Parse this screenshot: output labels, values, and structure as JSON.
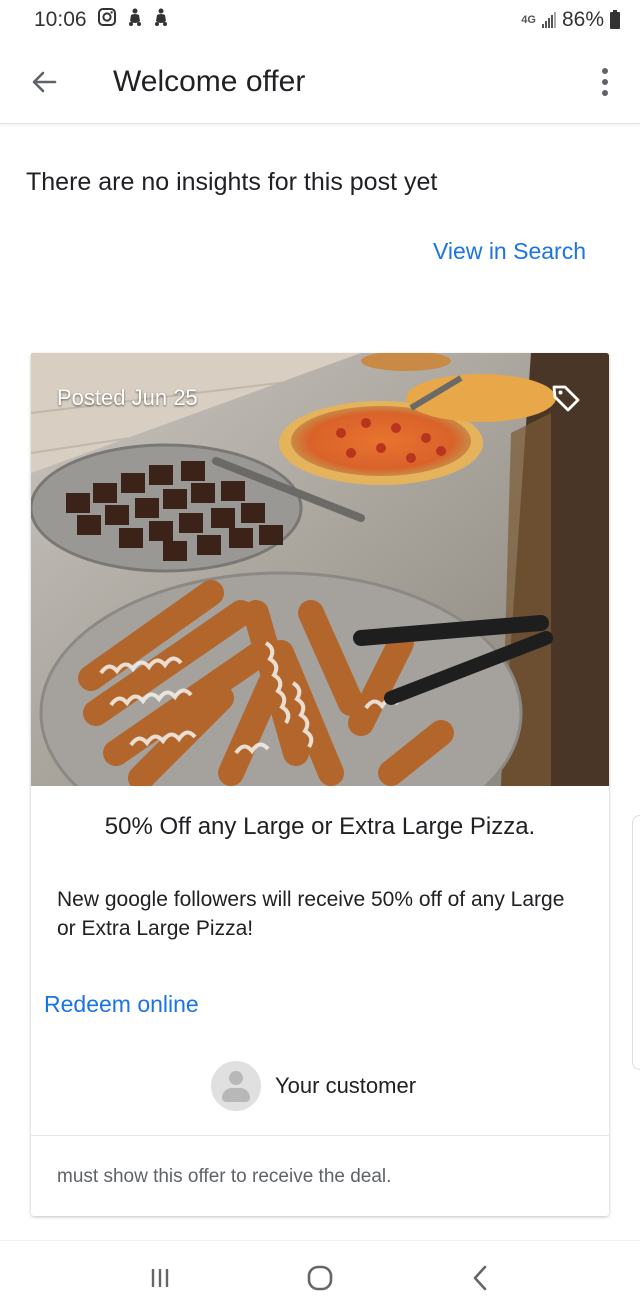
{
  "status_bar": {
    "time": "10:06",
    "network": "4G",
    "battery": "86%",
    "icons": [
      "instagram-icon",
      "notification-icon",
      "notification-icon"
    ]
  },
  "app_bar": {
    "title": "Welcome offer",
    "back_icon": "arrow-back-icon",
    "menu_icon": "more-vert-icon"
  },
  "insights": {
    "message": "There are no insights for this post yet",
    "link": "View in Search"
  },
  "post": {
    "posted": "Posted Jun 25",
    "tag_icon": "tag-icon",
    "photo_alt": "food-photo",
    "title": "50% Off any Large or Extra Large Pizza.",
    "description": "New google followers will receive 50% off of any Large or Extra Large Pizza!",
    "cta": "Redeem online",
    "customer_label": "Your customer",
    "terms": "must show this offer to receive the deal."
  },
  "nav_bar": {
    "icons": [
      "recents-icon",
      "home-icon",
      "back-icon"
    ]
  },
  "colors": {
    "link": "#1a73e8",
    "text": "#202124"
  }
}
